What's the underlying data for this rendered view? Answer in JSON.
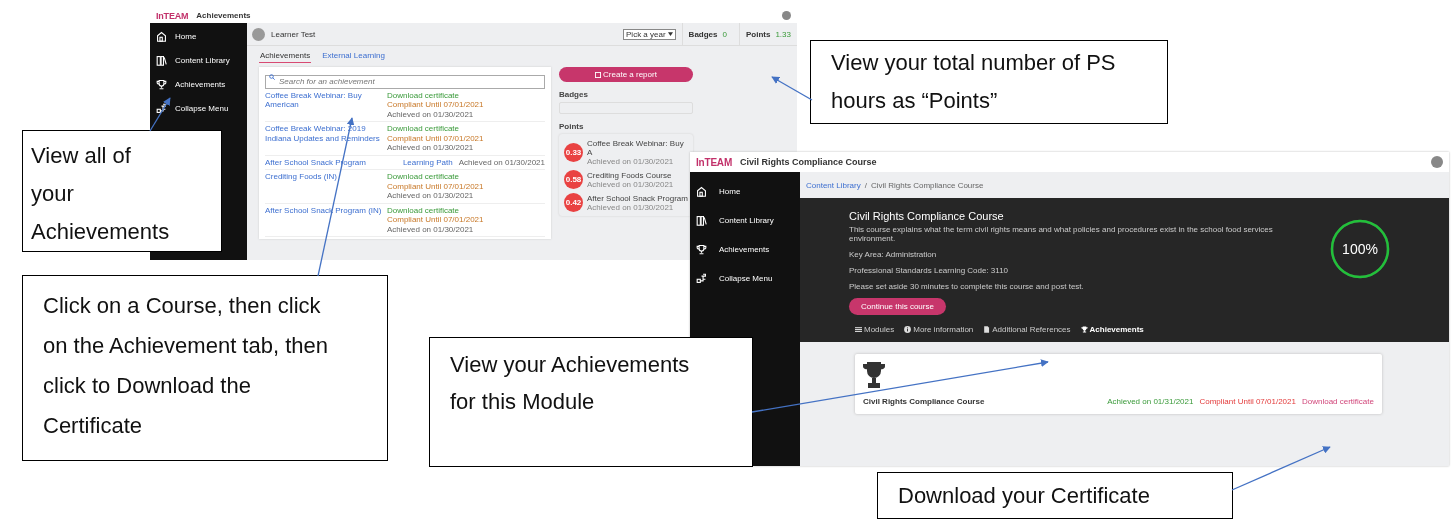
{
  "achievements_screen": {
    "logo": "InTEAM",
    "app_title": "Achievements",
    "sidebar": {
      "items": [
        {
          "label": "Home"
        },
        {
          "label": "Content Library"
        },
        {
          "label": "Achievements"
        },
        {
          "label": "Collapse Menu"
        }
      ]
    },
    "user": {
      "name": "Learner Test"
    },
    "year_select": {
      "value": "Pick a year"
    },
    "stats": [
      {
        "label": "Badges",
        "value": "0"
      },
      {
        "label": "Points",
        "value": "1.33"
      }
    ],
    "tabs": [
      {
        "label": "Achievements",
        "selected": true
      },
      {
        "label": "External Learning",
        "selected": false
      }
    ],
    "search": {
      "placeholder": "Search for an achievement"
    },
    "achievements": [
      {
        "kind": "certificate",
        "title": "Coffee Break Webinar: Buy American",
        "download": "Download certificate",
        "compliance": "Compliant Until 07/01/2021",
        "achieved": "Achieved on 01/30/2021"
      },
      {
        "kind": "certificate",
        "title": "Coffee Break Webinar: 2019 Indiana Updates and Reminders",
        "download": "Download certificate",
        "compliance": "Compliant Until 07/01/2021",
        "achieved": "Achieved on 01/30/2021"
      },
      {
        "kind": "path",
        "title": "After School Snack Program",
        "path_label": "Learning Path",
        "achieved": "Achieved on 01/30/2021"
      },
      {
        "kind": "certificate",
        "title": "Crediting Foods (IN)",
        "download": "Download certificate",
        "compliance": "Compliant Until 07/01/2021",
        "achieved": "Achieved on 01/30/2021"
      },
      {
        "kind": "certificate",
        "title": "After School Snack Program (IN)",
        "download": "Download certificate",
        "compliance": "Compliant Until 07/01/2021",
        "achieved": "Achieved on 01/30/2021"
      }
    ],
    "report_button": "Create a report",
    "badges": {
      "heading": "Badges"
    },
    "points": {
      "heading": "Points",
      "items": [
        {
          "value": "0.33",
          "title": "Coffee Break Webinar: Buy A",
          "achieved": "Achieved on 01/30/2021"
        },
        {
          "value": "0.58",
          "title": "Crediting Foods Course",
          "achieved": "Achieved on 01/30/2021"
        },
        {
          "value": "0.42",
          "title": "After School Snack Program",
          "achieved": "Achieved on 01/30/2021"
        }
      ]
    }
  },
  "course_screen": {
    "logo": "InTEAM",
    "app_title": "Civil Rights Compliance Course",
    "sidebar": {
      "items": [
        {
          "label": "Home"
        },
        {
          "label": "Content Library"
        },
        {
          "label": "Achievements"
        },
        {
          "label": "Collapse Menu"
        }
      ]
    },
    "breadcrumb": {
      "items": [
        {
          "label": "Content Library",
          "kind": "link"
        },
        {
          "label": "Civil Rights Compliance Course",
          "kind": "current"
        }
      ],
      "separator": "/"
    },
    "course": {
      "title": "Civil Rights Compliance Course",
      "description": "This course explains what the term civil rights means and what policies and procedures exist in the school food services environment.",
      "details": [
        "Key Area: Administration",
        "Professional Standards Learning Code: 3110",
        "Please set aside 30 minutes to complete this course and post test."
      ],
      "progress": {
        "label": "100%",
        "level": 1
      },
      "continue_button": "Continue this course",
      "tabs": [
        {
          "label": "Modules",
          "selected": false
        },
        {
          "label": "More information",
          "selected": false
        },
        {
          "label": "Additional References",
          "selected": false
        },
        {
          "label": "Achievements",
          "selected": true
        }
      ]
    },
    "achievement_card": {
      "title": "Civil Rights Compliance Course",
      "achieved": "Achieved on 01/31/2021",
      "compliance": "Compliant Until 07/01/2021",
      "download": "Download certificate"
    }
  },
  "callouts": [
    {
      "text": "View your total number of PS hours as “Points”"
    },
    {
      "text": "View all of your Achievements"
    },
    {
      "text": "Click on a Course, then click on the Achievement tab, then click to Download the Certificate"
    },
    {
      "text": "View your Achievements for this Module"
    },
    {
      "text": "Download your Certificate"
    }
  ]
}
